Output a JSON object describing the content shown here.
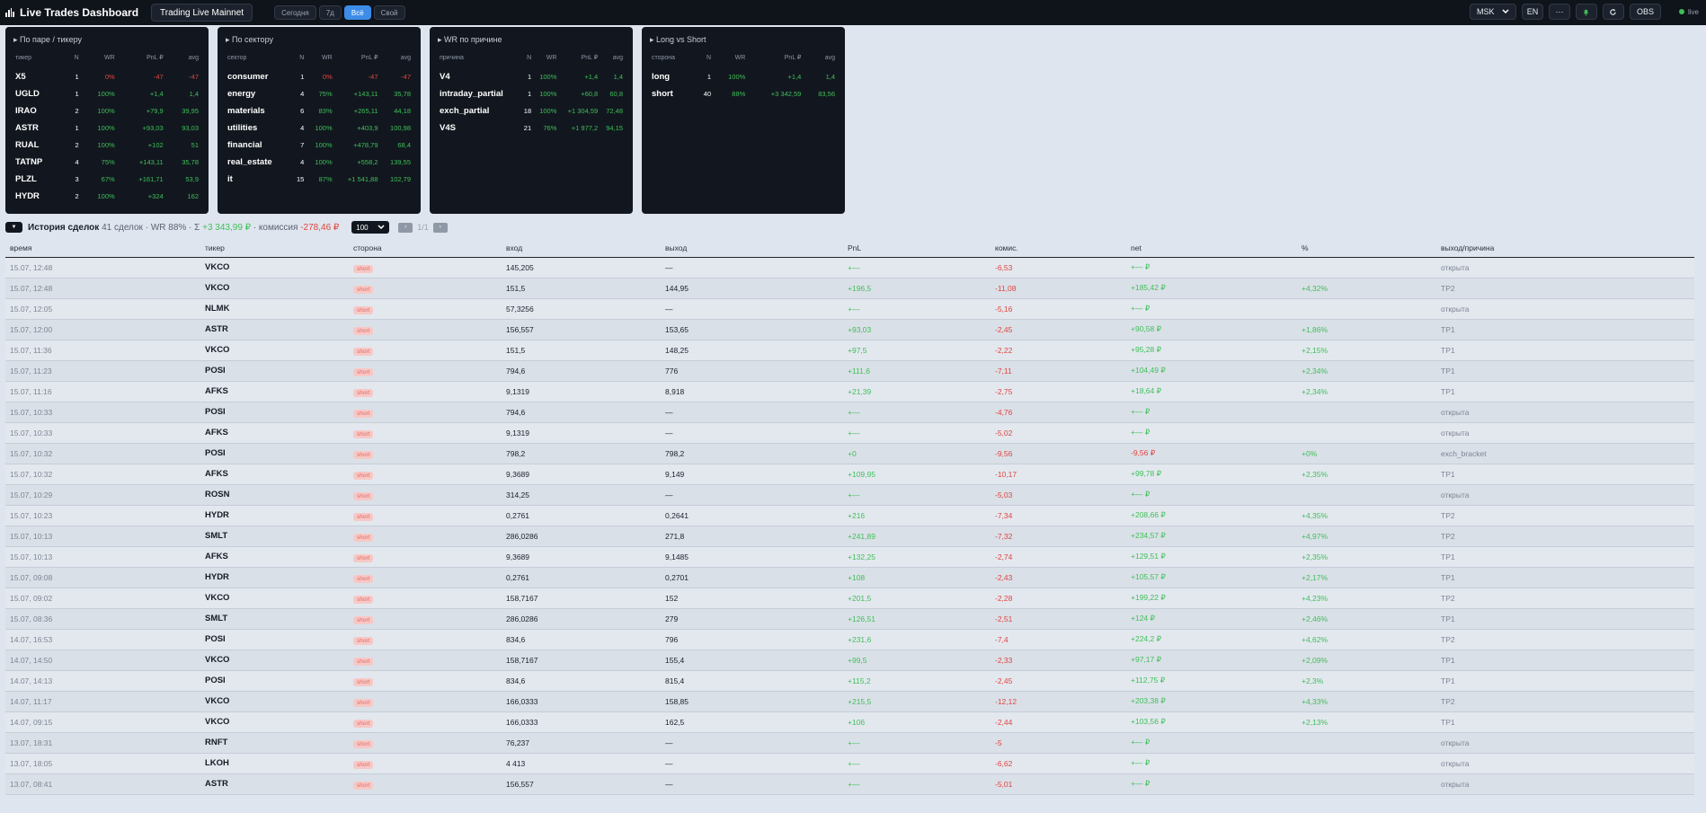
{
  "app": {
    "title": "Live Trades Dashboard",
    "mode": "Trading Live Mainnet"
  },
  "ranges": [
    {
      "label": "Сегодня",
      "active": false
    },
    {
      "label": "7д",
      "active": false
    },
    {
      "label": "Всё",
      "active": true
    },
    {
      "label": "Свой",
      "active": false
    }
  ],
  "top_right": {
    "timezone": "MSK",
    "lang": "EN",
    "more": "···",
    "bell_icon": "bell-icon",
    "refresh_icon": "refresh-icon",
    "obs": "OBS",
    "live": "live"
  },
  "colors": {
    "positive": "#3fbf58",
    "negative": "#e0453c",
    "accent": "#3d8ce8",
    "card_bg": "#12171f"
  },
  "cards": [
    {
      "title": "▸ По паре / тикеру",
      "headers": [
        "тикер",
        "N",
        "WR",
        "PnL ₽",
        "avg"
      ],
      "rows": [
        [
          "X5",
          "1",
          "0%",
          "-47",
          "-47"
        ],
        [
          "UGLD",
          "1",
          "100%",
          "+1,4",
          "1,4"
        ],
        [
          "IRAO",
          "2",
          "100%",
          "+79,9",
          "39,95"
        ],
        [
          "ASTR",
          "1",
          "100%",
          "+93,03",
          "93,03"
        ],
        [
          "RUAL",
          "2",
          "100%",
          "+102",
          "51"
        ],
        [
          "TATNP",
          "4",
          "75%",
          "+143,11",
          "35,78"
        ],
        [
          "PLZL",
          "3",
          "67%",
          "+161,71",
          "53,9"
        ],
        [
          "HYDR",
          "2",
          "100%",
          "+324",
          "162"
        ]
      ]
    },
    {
      "title": "▸ По сектору",
      "headers": [
        "сектор",
        "N",
        "WR",
        "PnL ₽",
        "avg"
      ],
      "rows": [
        [
          "consumer",
          "1",
          "0%",
          "-47",
          "-47"
        ],
        [
          "energy",
          "4",
          "75%",
          "+143,11",
          "35,78"
        ],
        [
          "materials",
          "6",
          "83%",
          "+265,11",
          "44,18"
        ],
        [
          "utilities",
          "4",
          "100%",
          "+403,9",
          "100,98"
        ],
        [
          "financial",
          "7",
          "100%",
          "+478,79",
          "68,4"
        ],
        [
          "real_estate",
          "4",
          "100%",
          "+558,2",
          "139,55"
        ],
        [
          "it",
          "15",
          "87%",
          "+1 541,88",
          "102,79"
        ]
      ]
    },
    {
      "title": "▸ WR по причине",
      "headers": [
        "причина",
        "N",
        "WR",
        "PnL ₽",
        "avg"
      ],
      "rows": [
        [
          "V4",
          "1",
          "100%",
          "+1,4",
          "1,4"
        ],
        [
          "intraday_partial",
          "1",
          "100%",
          "+60,8",
          "60,8"
        ],
        [
          "exch_partial",
          "18",
          "100%",
          "+1 304,59",
          "72,48"
        ],
        [
          "V4S",
          "21",
          "76%",
          "+1 977,2",
          "94,15"
        ]
      ]
    },
    {
      "title": "▸ Long vs Short",
      "headers": [
        "сторона",
        "N",
        "WR",
        "PnL ₽",
        "avg"
      ],
      "rows": [
        [
          "long",
          "1",
          "100%",
          "+1,4",
          "1,4"
        ],
        [
          "short",
          "40",
          "88%",
          "+3 342,59",
          "83,56"
        ]
      ]
    }
  ],
  "history": {
    "title": "История сделок",
    "count": "41 сделок · WR 88% · Σ",
    "sum": "+3 343,99 ₽",
    "commission_label": "· комиссия",
    "commission": "-278,46 ₽",
    "page_size": "100",
    "page_info": "1/1",
    "prev": "‹",
    "next": "›",
    "columns": [
      "время",
      "тикер",
      "сторона",
      "вход",
      "выход",
      "PnL",
      "комис.",
      "net",
      "%",
      "выход/причина"
    ],
    "rows": [
      [
        "15.07, 12:48",
        "VKCO",
        "short",
        "145,205",
        "—",
        "+—",
        "-6,53",
        "+— ₽",
        "",
        "открыта"
      ],
      [
        "15.07, 12:48",
        "VKCO",
        "short",
        "151,5",
        "144,95",
        "+196,5",
        "-11,08",
        "+185,42 ₽",
        "+4,32%",
        "TP2"
      ],
      [
        "15.07, 12:05",
        "NLMK",
        "short",
        "57,3256",
        "—",
        "+—",
        "-5,16",
        "+— ₽",
        "",
        "открыта"
      ],
      [
        "15.07, 12:00",
        "ASTR",
        "short",
        "156,557",
        "153,65",
        "+93,03",
        "-2,45",
        "+90,58 ₽",
        "+1,86%",
        "TP1"
      ],
      [
        "15.07, 11:36",
        "VKCO",
        "short",
        "151,5",
        "148,25",
        "+97,5",
        "-2,22",
        "+95,28 ₽",
        "+2,15%",
        "TP1"
      ],
      [
        "15.07, 11:23",
        "POSI",
        "short",
        "794,6",
        "776",
        "+111,6",
        "-7,11",
        "+104,49 ₽",
        "+2,34%",
        "TP1"
      ],
      [
        "15.07, 11:16",
        "AFKS",
        "short",
        "9,1319",
        "8,918",
        "+21,39",
        "-2,75",
        "+18,64 ₽",
        "+2,34%",
        "TP1"
      ],
      [
        "15.07, 10:33",
        "POSI",
        "short",
        "794,6",
        "—",
        "+—",
        "-4,76",
        "+— ₽",
        "",
        "открыта"
      ],
      [
        "15.07, 10:33",
        "AFKS",
        "short",
        "9,1319",
        "—",
        "+—",
        "-5,02",
        "+— ₽",
        "",
        "открыта"
      ],
      [
        "15.07, 10:32",
        "POSI",
        "short",
        "798,2",
        "798,2",
        "+0",
        "-9,56",
        "-9,56 ₽",
        "+0%",
        "exch_bracket"
      ],
      [
        "15.07, 10:32",
        "AFKS",
        "short",
        "9,3689",
        "9,149",
        "+109,95",
        "-10,17",
        "+99,78 ₽",
        "+2,35%",
        "TP1"
      ],
      [
        "15.07, 10:29",
        "ROSN",
        "short",
        "314,25",
        "—",
        "+—",
        "-5,03",
        "+— ₽",
        "",
        "открыта"
      ],
      [
        "15.07, 10:23",
        "HYDR",
        "short",
        "0,2761",
        "0,2641",
        "+216",
        "-7,34",
        "+208,66 ₽",
        "+4,35%",
        "TP2"
      ],
      [
        "15.07, 10:13",
        "SMLT",
        "short",
        "286,0286",
        "271,8",
        "+241,89",
        "-7,32",
        "+234,57 ₽",
        "+4,97%",
        "TP2"
      ],
      [
        "15.07, 10:13",
        "AFKS",
        "short",
        "9,3689",
        "9,1485",
        "+132,25",
        "-2,74",
        "+129,51 ₽",
        "+2,35%",
        "TP1"
      ],
      [
        "15.07, 09:08",
        "HYDR",
        "short",
        "0,2761",
        "0,2701",
        "+108",
        "-2,43",
        "+105,57 ₽",
        "+2,17%",
        "TP1"
      ],
      [
        "15.07, 09:02",
        "VKCO",
        "short",
        "158,7167",
        "152",
        "+201,5",
        "-2,28",
        "+199,22 ₽",
        "+4,23%",
        "TP2"
      ],
      [
        "15.07, 08:36",
        "SMLT",
        "short",
        "286,0286",
        "279",
        "+126,51",
        "-2,51",
        "+124 ₽",
        "+2,46%",
        "TP1"
      ],
      [
        "14.07, 16:53",
        "POSI",
        "short",
        "834,6",
        "796",
        "+231,6",
        "-7,4",
        "+224,2 ₽",
        "+4,62%",
        "TP2"
      ],
      [
        "14.07, 14:50",
        "VKCO",
        "short",
        "158,7167",
        "155,4",
        "+99,5",
        "-2,33",
        "+97,17 ₽",
        "+2,09%",
        "TP1"
      ],
      [
        "14.07, 14:13",
        "POSI",
        "short",
        "834,6",
        "815,4",
        "+115,2",
        "-2,45",
        "+112,75 ₽",
        "+2,3%",
        "TP1"
      ],
      [
        "14.07, 11:17",
        "VKCO",
        "short",
        "166,0333",
        "158,85",
        "+215,5",
        "-12,12",
        "+203,38 ₽",
        "+4,33%",
        "TP2"
      ],
      [
        "14.07, 09:15",
        "VKCO",
        "short",
        "166,0333",
        "162,5",
        "+106",
        "-2,44",
        "+103,56 ₽",
        "+2,13%",
        "TP1"
      ],
      [
        "13.07, 18:31",
        "RNFT",
        "short",
        "76,237",
        "—",
        "+—",
        "-5",
        "+— ₽",
        "",
        "открыта"
      ],
      [
        "13.07, 18:05",
        "LKOH",
        "short",
        "4 413",
        "—",
        "+—",
        "-6,62",
        "+— ₽",
        "",
        "открыта"
      ],
      [
        "13.07, 08:41",
        "ASTR",
        "short",
        "156,557",
        "—",
        "+—",
        "-5,01",
        "+— ₽",
        "",
        "открыта"
      ]
    ]
  }
}
